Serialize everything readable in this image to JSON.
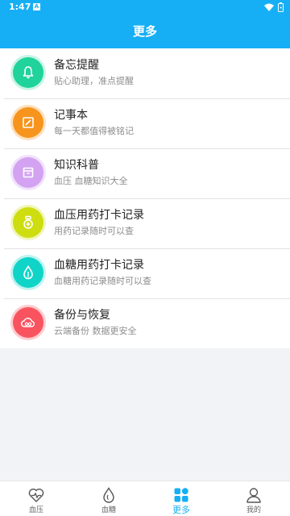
{
  "status": {
    "time": "1:47",
    "notif_letter": "A"
  },
  "header": {
    "title": "更多"
  },
  "colors": {
    "accent": "#16aff5"
  },
  "menu": [
    {
      "title": "备忘提醒",
      "subtitle": "贴心助理，准点提醒",
      "icon": "bell-icon",
      "color": "#1fd39a"
    },
    {
      "title": "记事本",
      "subtitle": "每一天都值得被铭记",
      "icon": "notebook-icon",
      "color": "#f7941d"
    },
    {
      "title": "知识科普",
      "subtitle": "血压 血糖知识大全",
      "icon": "book-icon",
      "color": "#d3a3f2"
    },
    {
      "title": "血压用药打卡记录",
      "subtitle": "用药记录随时可以查",
      "icon": "pill-bottle-icon",
      "color": "#cddd10"
    },
    {
      "title": "血糖用药打卡记录",
      "subtitle": "血糖用药记录随时可以查",
      "icon": "droplet-icon",
      "color": "#10d4c8"
    },
    {
      "title": "备份与恢复",
      "subtitle": "云端备份 数据更安全",
      "icon": "cloud-icon",
      "color": "#fa5360"
    }
  ],
  "tabs": [
    {
      "label": "血压",
      "icon": "heart-pulse-icon",
      "active": false
    },
    {
      "label": "血糖",
      "icon": "droplet-outline-icon",
      "active": false
    },
    {
      "label": "更多",
      "icon": "grid-icon",
      "active": true
    },
    {
      "label": "我的",
      "icon": "person-icon",
      "active": false
    }
  ]
}
